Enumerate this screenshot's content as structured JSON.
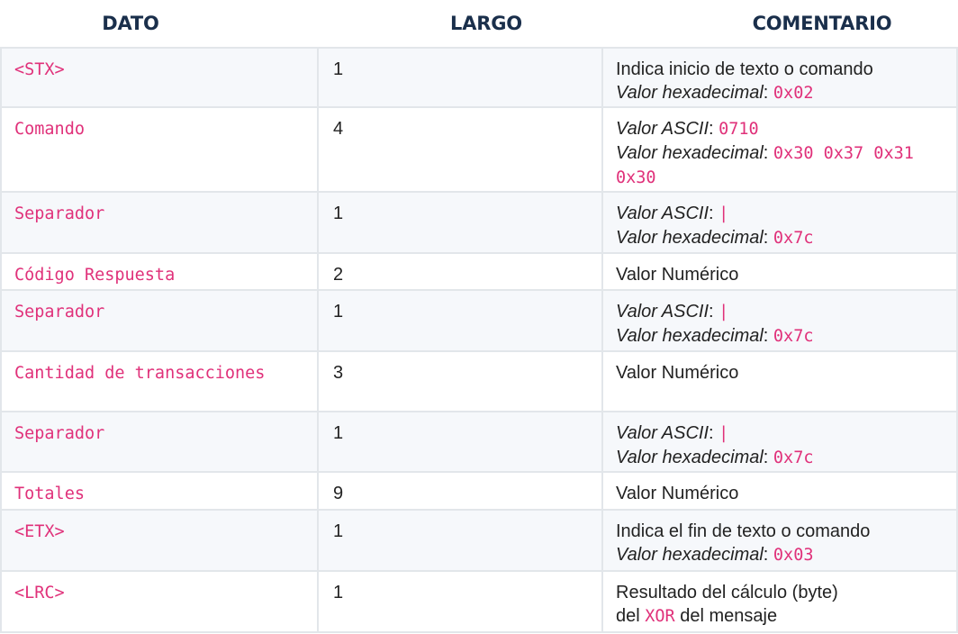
{
  "headers": {
    "dato": "DATO",
    "largo": "LARGO",
    "comentario": "COMENTARIO"
  },
  "rows": [
    {
      "dato": "<STX>",
      "largo": "1",
      "c_line1_text": "Indica inicio de texto o comando",
      "c_line2_label": "Valor hexadecimal",
      "c_line2_code": "0x02"
    },
    {
      "dato": "Comando",
      "largo": "4",
      "c_line1_label": "Valor ASCII",
      "c_line1_code": "0710",
      "c_line2_label": "Valor hexadecimal",
      "c_line2_code": "0x30 0x37 0x31",
      "c_line3_code": "0x30"
    },
    {
      "dato": "Separador",
      "largo": "1",
      "c_line1_label": "Valor ASCII",
      "c_line1_code": "|",
      "c_line2_label": "Valor hexadecimal",
      "c_line2_code": "0x7c"
    },
    {
      "dato": "Código Respuesta",
      "largo": "2",
      "c_line1_text": "Valor Numérico"
    },
    {
      "dato": "Separador",
      "largo": "1",
      "c_line1_label": "Valor ASCII",
      "c_line1_code": "|",
      "c_line2_label": "Valor hexadecimal",
      "c_line2_code": "0x7c"
    },
    {
      "dato": "Cantidad de transacciones",
      "largo": "3",
      "c_line1_text": "Valor Numérico"
    },
    {
      "dato": "Separador",
      "largo": "1",
      "c_line1_label": "Valor ASCII",
      "c_line1_code": "|",
      "c_line2_label": "Valor hexadecimal",
      "c_line2_code": "0x7c"
    },
    {
      "dato": "Totales",
      "largo": "9",
      "c_line1_text": "Valor Numérico"
    },
    {
      "dato": "<ETX>",
      "largo": "1",
      "c_line1_text": "Indica el fin de texto o comando",
      "c_line2_label": "Valor hexadecimal",
      "c_line2_code": "0x03"
    },
    {
      "dato": "<LRC>",
      "largo": "1",
      "c_line1_text": "Resultado del cálculo (byte)",
      "c_line2_pre": "del",
      "c_line2_code": "XOR",
      "c_line2_post": "del mensaje"
    }
  ],
  "colors": {
    "header_text": "#1a2f4b",
    "code_text": "#e0317a",
    "row_odd": "#f6f8fb",
    "row_even": "#ffffff",
    "border": "#e2e6ea"
  }
}
